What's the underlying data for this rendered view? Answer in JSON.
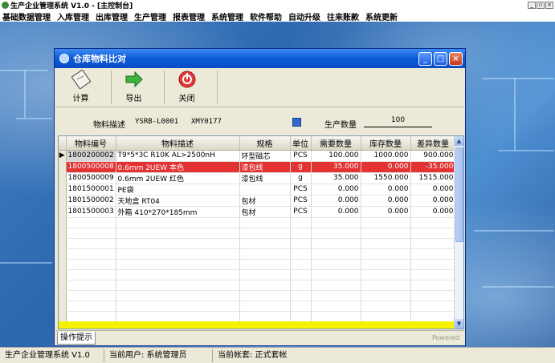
{
  "app": {
    "title": "生产企业管理系统 V1.0 - [主控制台]"
  },
  "menu": [
    "基础数据管理",
    "入库管理",
    "出库管理",
    "生产管理",
    "报表管理",
    "系统管理",
    "软件帮助",
    "自动升级",
    "往来账款",
    "系统更新"
  ],
  "dialog": {
    "title": "仓库物料比对",
    "toolbar": {
      "calc": "计算",
      "export": "导出",
      "close": "关闭"
    },
    "filter": {
      "material_label": "物料描述",
      "material_code": "YSRB-L0001",
      "material_name": "XMY0177",
      "qty_label": "生产数量",
      "qty_value": "100"
    },
    "table": {
      "headers": [
        "物料编号",
        "物料描述",
        "规格",
        "单位",
        "需要数量",
        "库存数量",
        "差异数量"
      ],
      "rows": [
        [
          "1800200002",
          "T9*5*3C  R10K    AL>2500nH",
          "环型磁芯",
          "PCS",
          "100.000",
          "1000.000",
          "900.000"
        ],
        [
          "1800500008",
          "0.6mm  2UEW  本色",
          "漆包线",
          "g",
          "35.000",
          "0.000",
          "-35.000"
        ],
        [
          "1800500009",
          "0.6mm  2UEW  红色",
          "漆包线",
          "g",
          "35.000",
          "1550.000",
          "1515.000"
        ],
        [
          "1801500001",
          "PE袋",
          "",
          "PCS",
          "0.000",
          "0.000",
          "0.000"
        ],
        [
          "1801500002",
          "天地盒 RT04",
          "包材",
          "PCS",
          "0.000",
          "0.000",
          "0.000"
        ],
        [
          "1801500003",
          "外箱  410*270*185mm",
          "包材",
          "PCS",
          "0.000",
          "0.000",
          "0.000"
        ]
      ]
    },
    "hint_tab": "操作提示",
    "powered": "Powered"
  },
  "status": {
    "app": "生产企业管理系统 V1.0",
    "user": "当前用户: 系统管理员",
    "account": "当前帐套: 正式套帐"
  },
  "colors": {
    "highlight_row": "#e33232",
    "title_bar": "#0b5ad8",
    "total_bar": "#f4f200"
  }
}
